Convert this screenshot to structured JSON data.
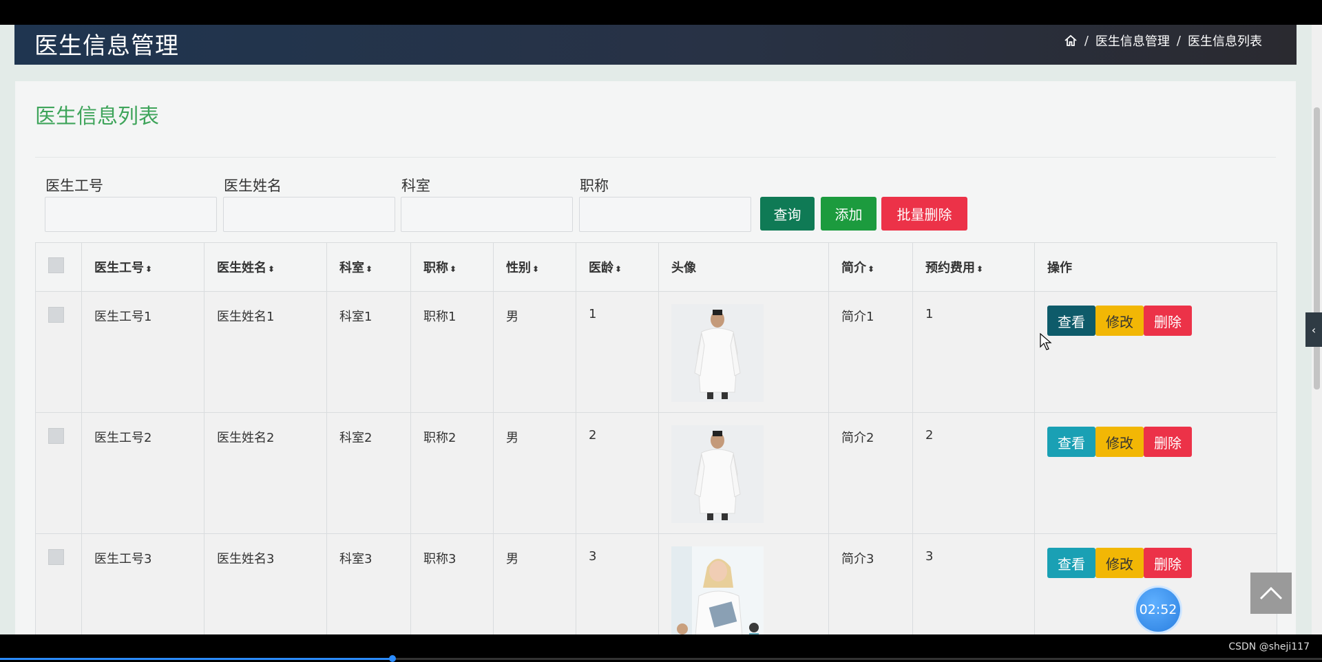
{
  "header": {
    "title": "医生信息管理",
    "breadcrumb": [
      "医生信息管理",
      "医生信息列表"
    ],
    "breadcrumb_sep": "/"
  },
  "page": {
    "list_title": "医生信息列表"
  },
  "filters": {
    "doctor_id_label": "医生工号",
    "doctor_name_label": "医生姓名",
    "department_label": "科室",
    "title_label": "职称",
    "doctor_id_value": "",
    "doctor_name_value": "",
    "department_value": "",
    "title_value": ""
  },
  "actions": {
    "search": "查询",
    "add": "添加",
    "batch_delete": "批量删除"
  },
  "table": {
    "columns": [
      "医生工号",
      "医生姓名",
      "科室",
      "职称",
      "性别",
      "医龄",
      "头像",
      "简介",
      "预约费用",
      "操作"
    ],
    "sort_icon": "⬍",
    "rows": [
      {
        "id": "医生工号1",
        "name": "医生姓名1",
        "dept": "科室1",
        "title": "职称1",
        "gender": "男",
        "years": "1",
        "intro": "简介1",
        "fee": "1"
      },
      {
        "id": "医生工号2",
        "name": "医生姓名2",
        "dept": "科室2",
        "title": "职称2",
        "gender": "男",
        "years": "2",
        "intro": "简介2",
        "fee": "2"
      },
      {
        "id": "医生工号3",
        "name": "医生姓名3",
        "dept": "科室3",
        "title": "职称3",
        "gender": "男",
        "years": "3",
        "intro": "简介3",
        "fee": "3"
      }
    ],
    "row_actions": {
      "view": "查看",
      "edit": "修改",
      "delete": "删除"
    }
  },
  "overlay": {
    "timer": "02:52",
    "watermark": "CSDN @sheji117",
    "video_progress": 0.297
  },
  "colors": {
    "search": "#0f7a55",
    "add": "#1c9b3e",
    "danger": "#ec3248",
    "view": "#1aa0b4",
    "view_active": "#0e5b6a",
    "edit": "#f2b705",
    "title_green": "#3ea45a"
  }
}
